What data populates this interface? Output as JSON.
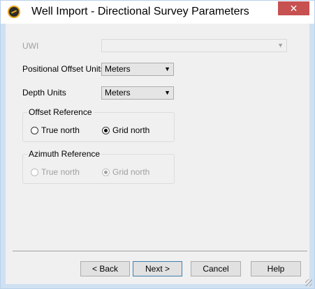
{
  "title": "Well Import - Directional Survey Parameters",
  "close_glyph": "✕",
  "uwi": {
    "label": "UWI",
    "value": "",
    "enabled": false
  },
  "positional_offset_units": {
    "label": "Positional Offset Units",
    "value": "Meters"
  },
  "depth_units": {
    "label": "Depth Units",
    "value": "Meters"
  },
  "offset_reference": {
    "title": "Offset Reference",
    "options": [
      {
        "label": "True north",
        "checked": false
      },
      {
        "label": "Grid north",
        "checked": true
      }
    ]
  },
  "azimuth_reference": {
    "title": "Azimuth Reference",
    "enabled": false,
    "options": [
      {
        "label": "True north",
        "checked": false
      },
      {
        "label": "Grid north",
        "checked": true
      }
    ]
  },
  "buttons": {
    "back": "< Back",
    "next": "Next >",
    "cancel": "Cancel",
    "help": "Help"
  },
  "dropdown_arrow": "▼"
}
